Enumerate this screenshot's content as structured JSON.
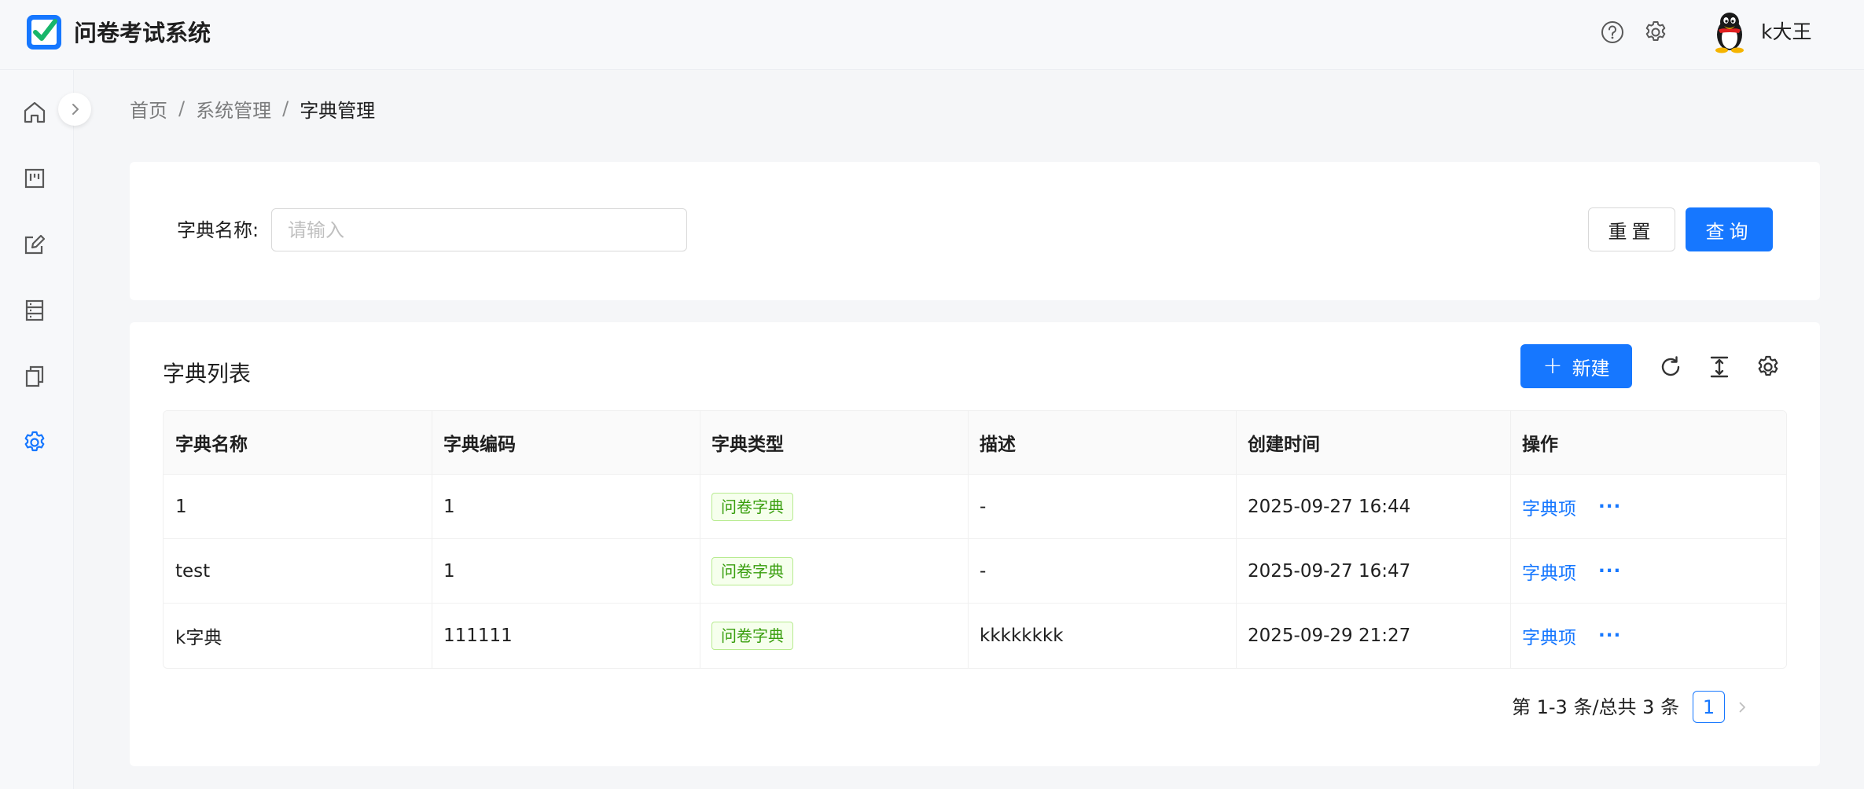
{
  "header": {
    "app_title": "问卷考试系统",
    "username": "k大王",
    "icons": {
      "help": "question-circle-icon",
      "settings": "gear-icon",
      "logo": "checkbox-logo-icon",
      "avatar": "penguin-avatar"
    }
  },
  "sidebar": {
    "items": [
      {
        "name": "home",
        "icon": "home-icon",
        "active": false
      },
      {
        "name": "dashboard",
        "icon": "board-icon",
        "active": false
      },
      {
        "name": "edit",
        "icon": "edit-icon",
        "active": false
      },
      {
        "name": "list",
        "icon": "list-icon",
        "active": false
      },
      {
        "name": "copy",
        "icon": "copy-icon",
        "active": false
      },
      {
        "name": "system",
        "icon": "gear-icon",
        "active": true
      }
    ]
  },
  "breadcrumb": {
    "items": [
      "首页",
      "系统管理",
      "字典管理"
    ],
    "separator": "/"
  },
  "search": {
    "label": "字典名称:",
    "placeholder": "请输入",
    "value": "",
    "reset_label": "重置",
    "query_label": "查询"
  },
  "table_card": {
    "title": "字典列表",
    "new_label": "新建",
    "columns": [
      "字典名称",
      "字典编码",
      "字典类型",
      "描述",
      "创建时间",
      "操作"
    ],
    "rows": [
      {
        "name": "1",
        "code": "1",
        "type": "问卷字典",
        "desc": "-",
        "created": "2025-09-27 16:44",
        "action": "字典项",
        "more": "···"
      },
      {
        "name": "test",
        "code": "1",
        "type": "问卷字典",
        "desc": "-",
        "created": "2025-09-27 16:47",
        "action": "字典项",
        "more": "···"
      },
      {
        "name": "k字典",
        "code": "111111",
        "type": "问卷字典",
        "desc": "kkkkkkkk",
        "created": "2025-09-29 21:27",
        "action": "字典项",
        "more": "···"
      }
    ]
  },
  "pagination": {
    "total_text": "第 1-3 条/总共 3 条",
    "current_page": "1"
  },
  "colors": {
    "primary": "#1677ff",
    "tag_text": "#389e0d",
    "tag_bg": "#f6ffed",
    "tag_border": "#b7eb8f",
    "logo_green": "#18b66a"
  }
}
